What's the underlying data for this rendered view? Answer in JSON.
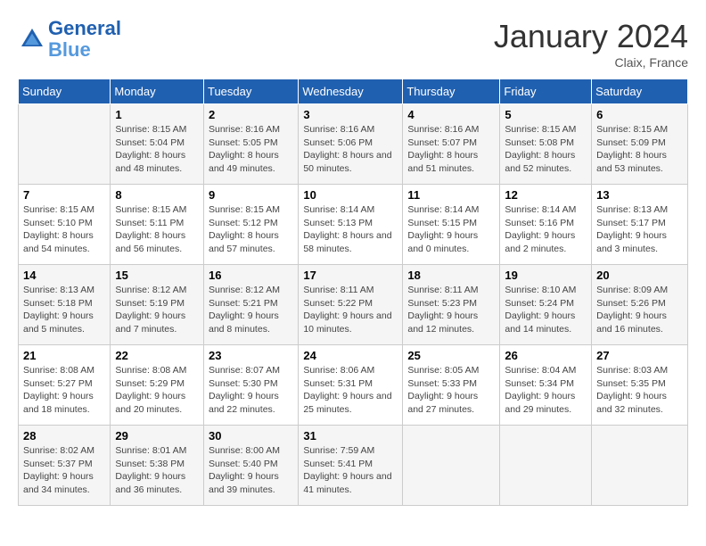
{
  "header": {
    "logo_line1": "General",
    "logo_line2": "Blue",
    "month": "January 2024",
    "location": "Claix, France"
  },
  "weekdays": [
    "Sunday",
    "Monday",
    "Tuesday",
    "Wednesday",
    "Thursday",
    "Friday",
    "Saturday"
  ],
  "weeks": [
    [
      {
        "day": "",
        "sunrise": "",
        "sunset": "",
        "daylight": ""
      },
      {
        "day": "1",
        "sunrise": "Sunrise: 8:15 AM",
        "sunset": "Sunset: 5:04 PM",
        "daylight": "Daylight: 8 hours and 48 minutes."
      },
      {
        "day": "2",
        "sunrise": "Sunrise: 8:16 AM",
        "sunset": "Sunset: 5:05 PM",
        "daylight": "Daylight: 8 hours and 49 minutes."
      },
      {
        "day": "3",
        "sunrise": "Sunrise: 8:16 AM",
        "sunset": "Sunset: 5:06 PM",
        "daylight": "Daylight: 8 hours and 50 minutes."
      },
      {
        "day": "4",
        "sunrise": "Sunrise: 8:16 AM",
        "sunset": "Sunset: 5:07 PM",
        "daylight": "Daylight: 8 hours and 51 minutes."
      },
      {
        "day": "5",
        "sunrise": "Sunrise: 8:15 AM",
        "sunset": "Sunset: 5:08 PM",
        "daylight": "Daylight: 8 hours and 52 minutes."
      },
      {
        "day": "6",
        "sunrise": "Sunrise: 8:15 AM",
        "sunset": "Sunset: 5:09 PM",
        "daylight": "Daylight: 8 hours and 53 minutes."
      }
    ],
    [
      {
        "day": "7",
        "sunrise": "Sunrise: 8:15 AM",
        "sunset": "Sunset: 5:10 PM",
        "daylight": "Daylight: 8 hours and 54 minutes."
      },
      {
        "day": "8",
        "sunrise": "Sunrise: 8:15 AM",
        "sunset": "Sunset: 5:11 PM",
        "daylight": "Daylight: 8 hours and 56 minutes."
      },
      {
        "day": "9",
        "sunrise": "Sunrise: 8:15 AM",
        "sunset": "Sunset: 5:12 PM",
        "daylight": "Daylight: 8 hours and 57 minutes."
      },
      {
        "day": "10",
        "sunrise": "Sunrise: 8:14 AM",
        "sunset": "Sunset: 5:13 PM",
        "daylight": "Daylight: 8 hours and 58 minutes."
      },
      {
        "day": "11",
        "sunrise": "Sunrise: 8:14 AM",
        "sunset": "Sunset: 5:15 PM",
        "daylight": "Daylight: 9 hours and 0 minutes."
      },
      {
        "day": "12",
        "sunrise": "Sunrise: 8:14 AM",
        "sunset": "Sunset: 5:16 PM",
        "daylight": "Daylight: 9 hours and 2 minutes."
      },
      {
        "day": "13",
        "sunrise": "Sunrise: 8:13 AM",
        "sunset": "Sunset: 5:17 PM",
        "daylight": "Daylight: 9 hours and 3 minutes."
      }
    ],
    [
      {
        "day": "14",
        "sunrise": "Sunrise: 8:13 AM",
        "sunset": "Sunset: 5:18 PM",
        "daylight": "Daylight: 9 hours and 5 minutes."
      },
      {
        "day": "15",
        "sunrise": "Sunrise: 8:12 AM",
        "sunset": "Sunset: 5:19 PM",
        "daylight": "Daylight: 9 hours and 7 minutes."
      },
      {
        "day": "16",
        "sunrise": "Sunrise: 8:12 AM",
        "sunset": "Sunset: 5:21 PM",
        "daylight": "Daylight: 9 hours and 8 minutes."
      },
      {
        "day": "17",
        "sunrise": "Sunrise: 8:11 AM",
        "sunset": "Sunset: 5:22 PM",
        "daylight": "Daylight: 9 hours and 10 minutes."
      },
      {
        "day": "18",
        "sunrise": "Sunrise: 8:11 AM",
        "sunset": "Sunset: 5:23 PM",
        "daylight": "Daylight: 9 hours and 12 minutes."
      },
      {
        "day": "19",
        "sunrise": "Sunrise: 8:10 AM",
        "sunset": "Sunset: 5:24 PM",
        "daylight": "Daylight: 9 hours and 14 minutes."
      },
      {
        "day": "20",
        "sunrise": "Sunrise: 8:09 AM",
        "sunset": "Sunset: 5:26 PM",
        "daylight": "Daylight: 9 hours and 16 minutes."
      }
    ],
    [
      {
        "day": "21",
        "sunrise": "Sunrise: 8:08 AM",
        "sunset": "Sunset: 5:27 PM",
        "daylight": "Daylight: 9 hours and 18 minutes."
      },
      {
        "day": "22",
        "sunrise": "Sunrise: 8:08 AM",
        "sunset": "Sunset: 5:29 PM",
        "daylight": "Daylight: 9 hours and 20 minutes."
      },
      {
        "day": "23",
        "sunrise": "Sunrise: 8:07 AM",
        "sunset": "Sunset: 5:30 PM",
        "daylight": "Daylight: 9 hours and 22 minutes."
      },
      {
        "day": "24",
        "sunrise": "Sunrise: 8:06 AM",
        "sunset": "Sunset: 5:31 PM",
        "daylight": "Daylight: 9 hours and 25 minutes."
      },
      {
        "day": "25",
        "sunrise": "Sunrise: 8:05 AM",
        "sunset": "Sunset: 5:33 PM",
        "daylight": "Daylight: 9 hours and 27 minutes."
      },
      {
        "day": "26",
        "sunrise": "Sunrise: 8:04 AM",
        "sunset": "Sunset: 5:34 PM",
        "daylight": "Daylight: 9 hours and 29 minutes."
      },
      {
        "day": "27",
        "sunrise": "Sunrise: 8:03 AM",
        "sunset": "Sunset: 5:35 PM",
        "daylight": "Daylight: 9 hours and 32 minutes."
      }
    ],
    [
      {
        "day": "28",
        "sunrise": "Sunrise: 8:02 AM",
        "sunset": "Sunset: 5:37 PM",
        "daylight": "Daylight: 9 hours and 34 minutes."
      },
      {
        "day": "29",
        "sunrise": "Sunrise: 8:01 AM",
        "sunset": "Sunset: 5:38 PM",
        "daylight": "Daylight: 9 hours and 36 minutes."
      },
      {
        "day": "30",
        "sunrise": "Sunrise: 8:00 AM",
        "sunset": "Sunset: 5:40 PM",
        "daylight": "Daylight: 9 hours and 39 minutes."
      },
      {
        "day": "31",
        "sunrise": "Sunrise: 7:59 AM",
        "sunset": "Sunset: 5:41 PM",
        "daylight": "Daylight: 9 hours and 41 minutes."
      },
      {
        "day": "",
        "sunrise": "",
        "sunset": "",
        "daylight": ""
      },
      {
        "day": "",
        "sunrise": "",
        "sunset": "",
        "daylight": ""
      },
      {
        "day": "",
        "sunrise": "",
        "sunset": "",
        "daylight": ""
      }
    ]
  ]
}
